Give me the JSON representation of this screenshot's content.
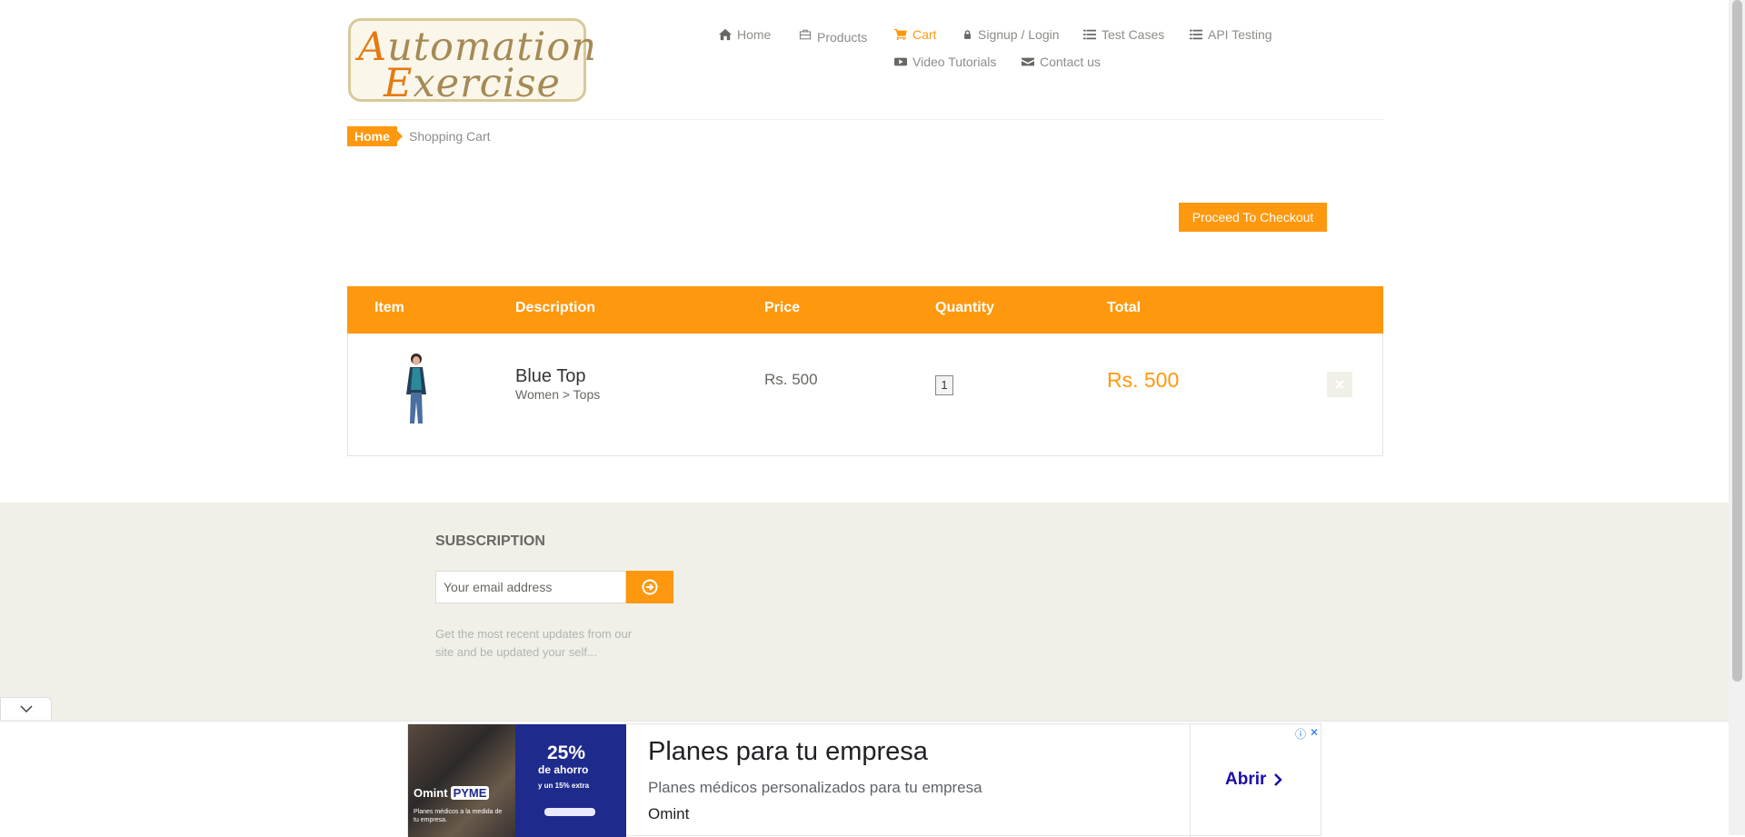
{
  "logo": {
    "line1": "utomation",
    "line1_cap": "A",
    "line2": "xercise",
    "line2_cap": "E"
  },
  "nav": {
    "home": "Home",
    "products": "Products",
    "cart": "Cart",
    "signup": "Signup / Login",
    "test_cases": "Test Cases",
    "api_testing": "API Testing",
    "video_tutorials": "Video Tutorials",
    "contact_us": "Contact us"
  },
  "breadcrumb": {
    "home": "Home",
    "current": "Shopping Cart"
  },
  "checkout_label": "Proceed To Checkout",
  "cart": {
    "headers": {
      "item": "Item",
      "description": "Description",
      "price": "Price",
      "quantity": "Quantity",
      "total": "Total"
    },
    "rows": [
      {
        "name": "Blue Top",
        "category": "Women > Tops",
        "price": "Rs. 500",
        "quantity": "1",
        "total": "Rs. 500"
      }
    ]
  },
  "footer": {
    "subscription_title": "SUBSCRIPTION",
    "email_placeholder": "Your email address",
    "note": "Get the most recent updates from our site and be updated your self..."
  },
  "ad": {
    "brand": "Omint",
    "brand_badge": "PYME",
    "tagline": "Planes médicos a la medida de tu empresa.",
    "promo_pct": "25%",
    "promo_sub": "de ahorro",
    "promo_extra": "y un 15% extra",
    "headline": "Planes para tu empresa",
    "description": "Planes médicos personalizados para tu empresa",
    "advertiser": "Omint",
    "cta": "Abrir"
  },
  "colors": {
    "accent": "#fe980f",
    "footer_bg": "#f0f0e9",
    "ad_blue": "#1e2a8c"
  }
}
